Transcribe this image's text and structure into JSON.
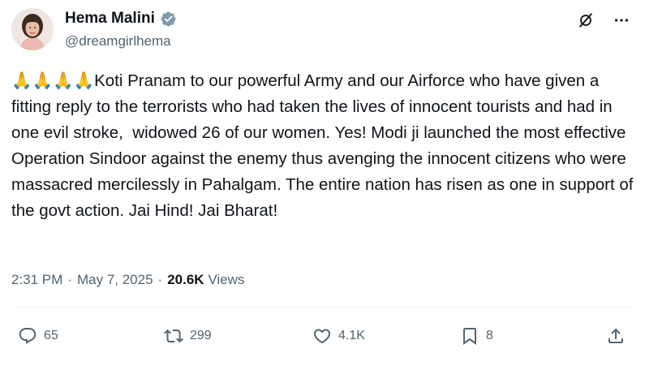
{
  "author": {
    "name": "Hema Malini",
    "handle": "@dreamgirlhema",
    "verified": true
  },
  "tweet": {
    "emoji": "🙏🙏🙏🙏",
    "text": "Koti Pranam to our powerful Army and our Airforce who have given a fitting reply to the terrorists who had taken the lives of innocent tourists and had in one evil stroke,  widowed 26 of our women. Yes! Modi ji launched the most effective Operation Sindoor against the enemy thus avenging the innocent citizens who were massacred mercilessly in Pahalgam. The entire nation has risen as one in support of the govt action. Jai Hind! Jai Bharat!"
  },
  "meta": {
    "time": "2:31 PM",
    "separator": "·",
    "date": "May 7, 2025",
    "views_count": "20.6K",
    "views_label": "Views"
  },
  "actions": {
    "replies": "65",
    "reposts": "299",
    "likes": "4.1K",
    "bookmarks": "8"
  },
  "colors": {
    "text": "#0f1419",
    "secondary": "#536471",
    "verified": "#829aab"
  }
}
